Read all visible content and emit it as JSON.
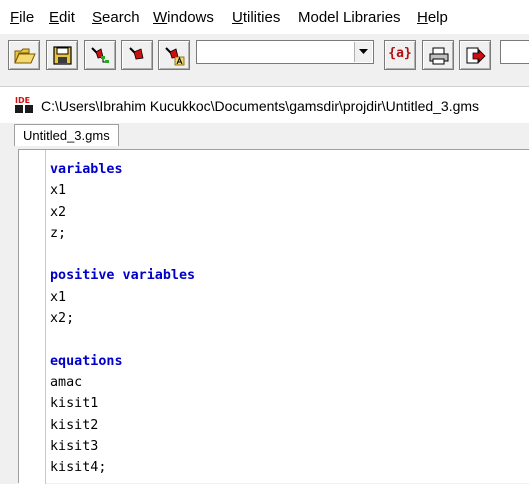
{
  "menubar": {
    "items": [
      {
        "underline": "F",
        "rest": "ile"
      },
      {
        "underline": "E",
        "rest": "dit"
      },
      {
        "underline": "S",
        "rest": "earch"
      },
      {
        "underline": "W",
        "rest": "indows"
      },
      {
        "underline": "U",
        "rest": "tilities"
      },
      {
        "underline": "",
        "rest": "Model Libraries"
      },
      {
        "underline": "H",
        "rest": "elp"
      }
    ]
  },
  "toolbar": {
    "buttons": [
      "open-folder-icon",
      "save-disk-icon",
      "run-tree-icon",
      "run-icon",
      "run-alt-icon"
    ],
    "combo_value": "",
    "model_lib_label": "{a}",
    "print_icon": "printer-icon",
    "goto_icon": "goto-arrow-icon"
  },
  "window": {
    "icon_text": "IDE",
    "title": "C:\\Users\\Ibrahim Kucukkoc\\Documents\\gamsdir\\projdir\\Untitled_3.gms",
    "tab_label": "Untitled_3.gms"
  },
  "editor": {
    "lines": [
      {
        "text": "variables",
        "keyword": true
      },
      {
        "text": "x1",
        "keyword": false
      },
      {
        "text": "x2",
        "keyword": false
      },
      {
        "text": "z;",
        "keyword": false
      },
      {
        "text": "",
        "keyword": false
      },
      {
        "text": "positive variables",
        "keyword": true
      },
      {
        "text": "x1",
        "keyword": false
      },
      {
        "text": "x2;",
        "keyword": false
      },
      {
        "text": "",
        "keyword": false
      },
      {
        "text": "equations",
        "keyword": true
      },
      {
        "text": "amac",
        "keyword": false
      },
      {
        "text": "kisit1",
        "keyword": false
      },
      {
        "text": "kisit2",
        "keyword": false
      },
      {
        "text": "kisit3",
        "keyword": false
      },
      {
        "text": "kisit4;",
        "keyword": false
      }
    ]
  },
  "colors": {
    "keyword": "#0000c8",
    "menubar_bg": "#ffffff",
    "chrome_bg": "#f0f0f0"
  }
}
